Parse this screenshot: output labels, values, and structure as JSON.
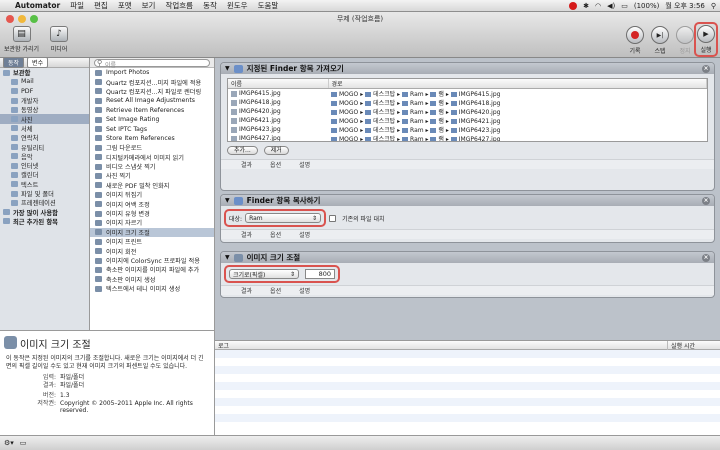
{
  "menubar": {
    "apple": "",
    "app": "Automator",
    "items": [
      "파일",
      "편집",
      "포맷",
      "보기",
      "작업흐름",
      "동작",
      "윈도우",
      "도움말"
    ],
    "battery": "(100%)",
    "clock": "월 오후 3:56"
  },
  "window": {
    "title": "무제 (작업흐름)"
  },
  "toolbar": {
    "hide_library": "보관함 가리기",
    "media": "미디어",
    "record": "기록",
    "step": "스텝",
    "stop": "정지",
    "run": "실행"
  },
  "library": {
    "tab_actions": "동작",
    "tab_variables": "변수",
    "items": [
      {
        "label": "보관함",
        "top": true
      },
      {
        "label": "Mail"
      },
      {
        "label": "PDF"
      },
      {
        "label": "개발자"
      },
      {
        "label": "동영상"
      },
      {
        "label": "사진",
        "selected": true
      },
      {
        "label": "서체"
      },
      {
        "label": "연락처"
      },
      {
        "label": "유틸리티"
      },
      {
        "label": "음악"
      },
      {
        "label": "인터넷"
      },
      {
        "label": "캘린더"
      },
      {
        "label": "텍스트"
      },
      {
        "label": "파일 및 폴더"
      },
      {
        "label": "프레젠테이션"
      },
      {
        "label": "가장 많이 사용함",
        "top": true
      },
      {
        "label": "최근 추가된 항목",
        "top": true
      }
    ]
  },
  "actions": {
    "search_placeholder": "이름",
    "items": [
      {
        "label": "Import Photos"
      },
      {
        "label": "Quartz 컴포지션...미지 파일에 적용"
      },
      {
        "label": "Quartz 컴포지션...지 파일로 렌더링"
      },
      {
        "label": "Reset All Image Adjustments"
      },
      {
        "label": "Retrieve Item References"
      },
      {
        "label": "Set Image Rating"
      },
      {
        "label": "Set IPTC Tags"
      },
      {
        "label": "Store Item References"
      },
      {
        "label": "그림 다운로드"
      },
      {
        "label": "디지털카메라에서 이미지 읽기"
      },
      {
        "label": "비디오 스냅샷 찍기"
      },
      {
        "label": "사진 찍기"
      },
      {
        "label": "새로운 PDF 밀착 인화지"
      },
      {
        "label": "이미지 뒤집기"
      },
      {
        "label": "이미지 여백 조정"
      },
      {
        "label": "이미지 유형 변경"
      },
      {
        "label": "이미지 자르기"
      },
      {
        "label": "이미지 크기 조절",
        "selected": true
      },
      {
        "label": "이미지 프린트"
      },
      {
        "label": "이미지 회전"
      },
      {
        "label": "이미지에 ColorSync 프로파일 적용"
      },
      {
        "label": "축소판 이미지를 이미지 파일에 추가"
      },
      {
        "label": "축소판 이미지 생성"
      },
      {
        "label": "텍스트에서 테니 이미지 생성"
      }
    ]
  },
  "description": {
    "title": "이미지 크기 조절",
    "body": "이 동작은 지정된 이미지의 크기를 조절합니다. 새로운 크기는 이미지에서 더 긴 면의 픽셀 길이일 수도 있고 현재 이미지 크기의 퍼센트일 수도 있습니다.",
    "input_label": "입력:",
    "input_value": "파일/폴더",
    "result_label": "결과:",
    "result_value": "파일/폴더",
    "version_label": "버전:",
    "version_value": "1.3",
    "copyright_label": "저작권:",
    "copyright_value": "Copyright © 2005–2011 Apple Inc. All rights reserved."
  },
  "workflow": {
    "action1": {
      "title": "지정된 Finder 항목 가져오기",
      "col_name": "이름",
      "col_path": "경로",
      "rows": [
        {
          "name": "IMGP6415.jpg",
          "path": [
            "MOGO",
            "데스크탑",
            "Ram",
            "램",
            "IMGP6415.jpg"
          ]
        },
        {
          "name": "IMGP6418.jpg",
          "path": [
            "MOGO",
            "데스크탑",
            "Ram",
            "램",
            "IMGP6418.jpg"
          ]
        },
        {
          "name": "IMGP6420.jpg",
          "path": [
            "MOGO",
            "데스크탑",
            "Ram",
            "램",
            "IMGP6420.jpg"
          ]
        },
        {
          "name": "IMGP6421.jpg",
          "path": [
            "MOGO",
            "데스크탑",
            "Ram",
            "램",
            "IMGP6421.jpg"
          ]
        },
        {
          "name": "IMGP6423.jpg",
          "path": [
            "MOGO",
            "데스크탑",
            "Ram",
            "램",
            "IMGP6423.jpg"
          ]
        },
        {
          "name": "IMGP6427.jpg",
          "path": [
            "MOGO",
            "데스크탑",
            "Ram",
            "램",
            "IMGP6427.jpg"
          ]
        }
      ],
      "add_button": "추가...",
      "remove_button": "제거",
      "foot": [
        "결과",
        "옵션",
        "설명"
      ]
    },
    "action2": {
      "title": "Finder 항목 복사하기",
      "target_label": "대상:",
      "target_value": "Ram",
      "replace_label": "기존의 파일 대치",
      "foot": [
        "결과",
        "옵션",
        "설명"
      ]
    },
    "action3": {
      "title": "이미지 크기 조절",
      "mode_value": "크기로(픽셀)",
      "size_value": "800",
      "foot": [
        "결과",
        "옵션",
        "설명"
      ]
    }
  },
  "log": {
    "col_log": "로그",
    "col_time": "실행 시간"
  }
}
